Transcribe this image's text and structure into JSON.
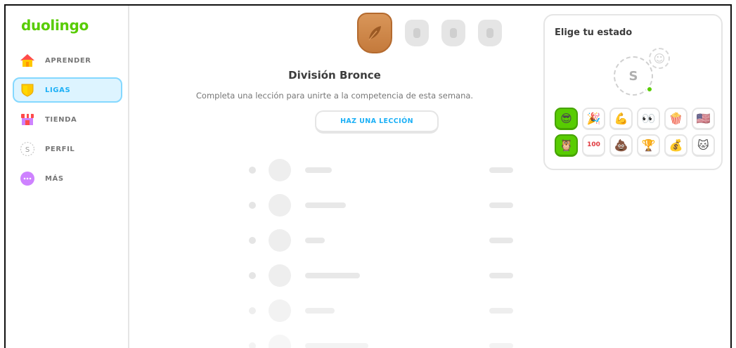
{
  "brand": {
    "logo": "duolingo"
  },
  "sidebar": {
    "items": [
      {
        "label": "APRENDER",
        "icon": "house-icon"
      },
      {
        "label": "LIGAS",
        "icon": "league-shield-icon",
        "active": true
      },
      {
        "label": "TIENDA",
        "icon": "shop-icon"
      },
      {
        "label": "PERFIL",
        "icon": "profile-avatar-icon",
        "avatar_letter": "S"
      },
      {
        "label": "MÁS",
        "icon": "more-icon"
      }
    ]
  },
  "league": {
    "title": "División Bronce",
    "subtitle": "Completa una lección para unirte a la competencia de esta semana.",
    "button_label": "HAZ UNA LECCIÓN",
    "bronze_color": "#cd7f3f"
  },
  "status_panel": {
    "title": "Elige tu estado",
    "avatar_letter": "S",
    "online_color": "#58cc02",
    "emojis": [
      {
        "name": "duo-sunglasses-emoji",
        "glyph": "😎"
      },
      {
        "name": "party-popper-emoji",
        "glyph": "🎉"
      },
      {
        "name": "flexed-biceps-emoji",
        "glyph": "💪"
      },
      {
        "name": "eyes-emoji",
        "glyph": "👀"
      },
      {
        "name": "popcorn-emoji",
        "glyph": "🍿"
      },
      {
        "name": "us-flag-emoji",
        "glyph": "🇺🇸"
      },
      {
        "name": "duo-owl-emoji",
        "glyph": "🦉"
      },
      {
        "name": "hundred-points-emoji",
        "glyph": "100"
      },
      {
        "name": "poop-emoji",
        "glyph": "💩"
      },
      {
        "name": "trophy-emoji",
        "glyph": "🏆"
      },
      {
        "name": "treasure-chest-emoji",
        "glyph": "💰"
      },
      {
        "name": "cat-emoji",
        "glyph": "🐱"
      }
    ]
  }
}
